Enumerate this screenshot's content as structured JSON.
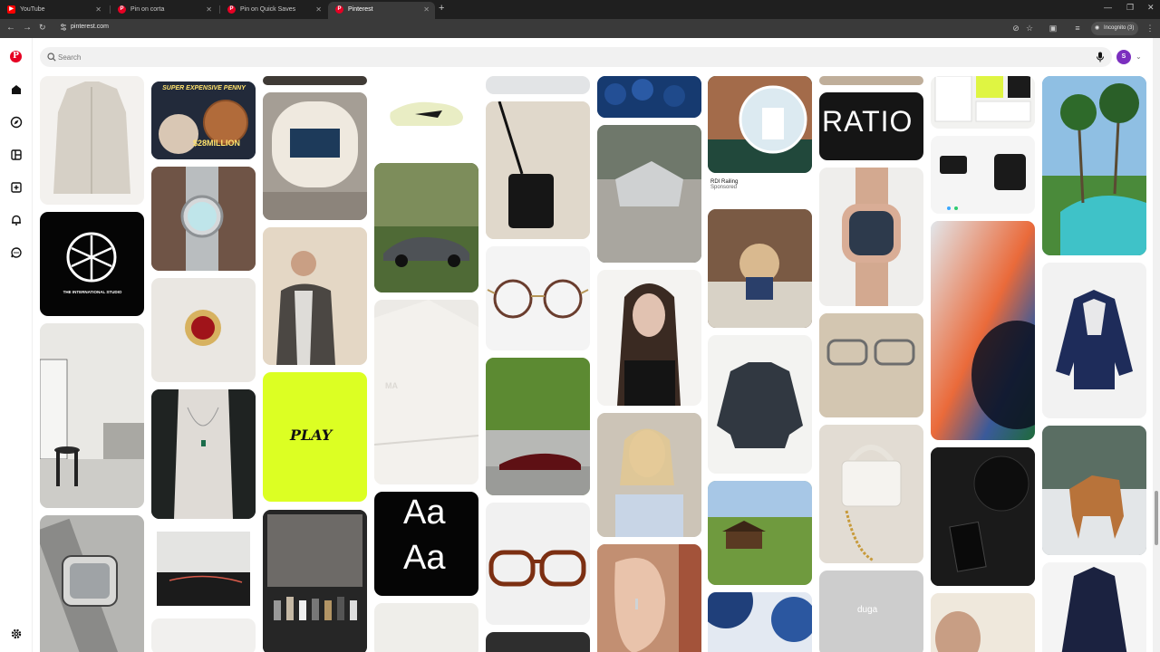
{
  "browser": {
    "tabs": [
      {
        "title": "YouTube",
        "icon": "youtube-icon",
        "active": false
      },
      {
        "title": "Pin on corta",
        "icon": "pinterest-icon",
        "active": false
      },
      {
        "title": "Pin on Quick Saves",
        "icon": "pinterest-icon",
        "active": false
      },
      {
        "title": "Pinterest",
        "icon": "pinterest-icon",
        "active": true
      }
    ],
    "new_tab": "+",
    "url": "pinterest.com",
    "incognito_label": "Incognito (3)"
  },
  "sidebar": {
    "logo": "P",
    "items": [
      "home-icon",
      "explore-icon",
      "boards-icon",
      "create-icon",
      "notifications-icon",
      "messages-icon"
    ],
    "settings": "gear-icon"
  },
  "search": {
    "placeholder": "Search"
  },
  "account": {
    "initial": "S"
  },
  "pins": {
    "sponsored_title": "RDI Railing",
    "sponsored_label": "Sponsored",
    "texts": {
      "penny": "SUPER EXPENSIVE PENNY",
      "penny_value": "$28MILLION",
      "studio": "THE INTERNATIONAL STUDIO",
      "play": "PLAY",
      "aa1": "Aa",
      "aa2": "Aa",
      "ratio": "RATIO",
      "duga": "duga",
      "shirt": "MA"
    }
  },
  "colors": {
    "brand": "#e60023",
    "avatar": "#7b2fbf"
  }
}
